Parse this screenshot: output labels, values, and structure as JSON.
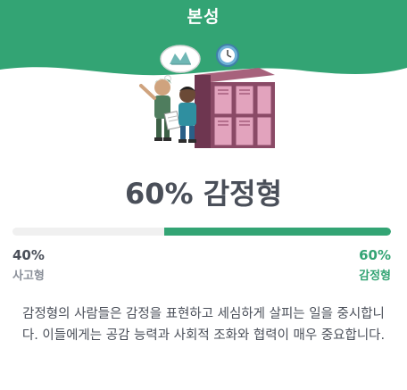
{
  "header": {
    "title": "본성",
    "bg_color": "#33a474"
  },
  "result": {
    "headline": "60% 감정형"
  },
  "scale": {
    "left": {
      "percent": "40%",
      "name": "사고형",
      "value": 0.4
    },
    "right": {
      "percent": "60%",
      "name": "감정형",
      "value": 0.6
    },
    "accent_color": "#33a474"
  },
  "description": "감정형의 사람들은 감정을 표현하고 세심하게 살피는 일을 중시합니다. 이들에게는 공감 능력과 사회적 조화와 협력이 매우 중요합니다."
}
